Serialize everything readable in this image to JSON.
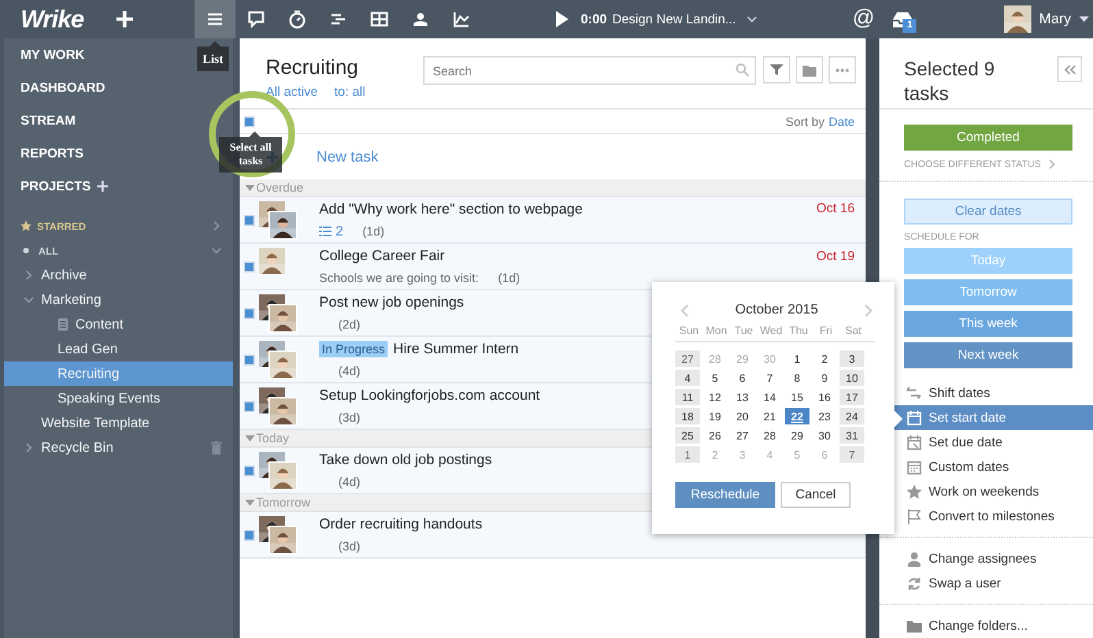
{
  "topbar": {
    "logo": "Wrike",
    "toolbar": [
      {
        "kind": "list",
        "selected": true
      },
      {
        "kind": "comment",
        "selected": false
      },
      {
        "kind": "timer",
        "selected": false
      },
      {
        "kind": "gantt",
        "selected": false
      },
      {
        "kind": "table",
        "selected": false
      },
      {
        "kind": "workload",
        "selected": false
      },
      {
        "kind": "chart",
        "selected": false
      }
    ],
    "tooltip": "List",
    "timer": {
      "time": "0:00",
      "task": "Design New Landin..."
    },
    "mentions": "@",
    "inbox_badge": "1",
    "user": "Mary"
  },
  "sidebar": {
    "nav": [
      "MY WORK",
      "DASHBOARD",
      "STREAM",
      "REPORTS"
    ],
    "projects_label": "PROJECTS",
    "starred": {
      "label": "STARRED",
      "expanded": false
    },
    "all": {
      "label": "ALL",
      "expanded": true
    },
    "tree": [
      {
        "label": "Archive",
        "kind": "folder",
        "expanded": false,
        "selected": false
      },
      {
        "label": "Marketing",
        "kind": "folder",
        "expanded": true,
        "selected": false,
        "children": [
          {
            "label": "Content",
            "kind": "document",
            "selected": false
          },
          {
            "label": "Lead Gen",
            "kind": "folder",
            "selected": false
          },
          {
            "label": "Recruiting",
            "kind": "folder",
            "selected": true
          },
          {
            "label": "Speaking Events",
            "kind": "folder",
            "selected": false
          }
        ]
      },
      {
        "label": "Website Template",
        "kind": "folder",
        "selected": false
      },
      {
        "label": "Recycle Bin",
        "kind": "bin",
        "expanded": false,
        "selected": false
      }
    ]
  },
  "list": {
    "title": "Recruiting",
    "filters": [
      "All active",
      "to: all"
    ],
    "search": {
      "placeholder": "Search"
    },
    "select_all": {
      "checked": true
    },
    "tooltip": "Select all tasks",
    "sort_label": "Sort by",
    "sort_value": "Date",
    "new_task": "New task",
    "groups": [
      {
        "label": "Overdue",
        "tasks": [
          {
            "title": "Add \"Why work here\" section to webpage",
            "checked": true,
            "subtasks": "2",
            "duration": "(1d)",
            "due": "Oct 16"
          },
          {
            "title": "College Career Fair",
            "checked": true,
            "description": "Schools we are going to visit:",
            "duration": "(1d)",
            "due": "Oct 19"
          },
          {
            "title": "Post new job openings",
            "checked": true,
            "duration": "(2d)"
          },
          {
            "title": "Hire Summer Intern",
            "status": "In Progress",
            "checked": true,
            "duration": "(4d)"
          },
          {
            "title": "Setup Lookingforjobs.com account",
            "checked": true,
            "duration": "(3d)"
          }
        ]
      },
      {
        "label": "Today",
        "tasks": [
          {
            "title": "Take down old job postings",
            "checked": true,
            "duration": "(4d)"
          }
        ]
      },
      {
        "label": "Tomorrow",
        "tasks": [
          {
            "title": "Order recruiting handouts",
            "checked": true,
            "duration": "(3d)"
          }
        ]
      }
    ]
  },
  "panel": {
    "title": "Selected 9 tasks",
    "status_button": "Completed",
    "status_link": "CHOOSE DIFFERENT STATUS",
    "clear_dates": "Clear dates",
    "schedule_label": "SCHEDULE FOR",
    "schedule": [
      {
        "label": "Today",
        "color": "#9dd0fa"
      },
      {
        "label": "Tomorrow",
        "color": "#7fbdf0"
      },
      {
        "label": "This week",
        "color": "#6aa6df"
      },
      {
        "label": "Next week",
        "color": "#6393c5"
      }
    ],
    "date_actions": [
      {
        "kind": "shift",
        "label": "Shift dates",
        "selected": false
      },
      {
        "kind": "start",
        "label": "Set start date",
        "selected": true
      },
      {
        "kind": "due",
        "label": "Set due date",
        "selected": false
      },
      {
        "kind": "custom",
        "label": "Custom dates",
        "selected": false
      },
      {
        "kind": "weekends",
        "label": "Work on weekends",
        "selected": false
      },
      {
        "kind": "milestones",
        "label": "Convert to milestones",
        "selected": false
      }
    ],
    "user_actions": [
      {
        "kind": "assignees",
        "label": "Change assignees",
        "selected": false
      },
      {
        "kind": "swap",
        "label": "Swap a user",
        "selected": false
      }
    ],
    "folder_actions": [
      {
        "kind": "folders",
        "label": "Change folders...",
        "selected": false
      }
    ]
  },
  "calendar": {
    "month": "October 2015",
    "weekdays": [
      "Sun",
      "Mon",
      "Tue",
      "Wed",
      "Thu",
      "Fri",
      "Sat"
    ],
    "weeks": [
      [
        {
          "day": "27",
          "muted": true,
          "selected": false
        },
        {
          "day": "28",
          "muted": true,
          "selected": false
        },
        {
          "day": "29",
          "muted": true,
          "selected": false
        },
        {
          "day": "30",
          "muted": true,
          "selected": false
        },
        {
          "day": "1",
          "muted": false,
          "selected": false
        },
        {
          "day": "2",
          "muted": false,
          "selected": false
        },
        {
          "day": "3",
          "muted": false,
          "selected": false
        }
      ],
      [
        {
          "day": "4",
          "muted": false,
          "selected": false
        },
        {
          "day": "5",
          "muted": false,
          "selected": false
        },
        {
          "day": "6",
          "muted": false,
          "selected": false
        },
        {
          "day": "7",
          "muted": false,
          "selected": false
        },
        {
          "day": "8",
          "muted": false,
          "selected": false
        },
        {
          "day": "9",
          "muted": false,
          "selected": false
        },
        {
          "day": "10",
          "muted": false,
          "selected": false
        }
      ],
      [
        {
          "day": "11",
          "muted": false,
          "selected": false
        },
        {
          "day": "12",
          "muted": false,
          "selected": false
        },
        {
          "day": "13",
          "muted": false,
          "selected": false
        },
        {
          "day": "14",
          "muted": false,
          "selected": false
        },
        {
          "day": "15",
          "muted": false,
          "selected": false
        },
        {
          "day": "16",
          "muted": false,
          "selected": false
        },
        {
          "day": "17",
          "muted": false,
          "selected": false
        }
      ],
      [
        {
          "day": "18",
          "muted": false,
          "selected": false
        },
        {
          "day": "19",
          "muted": false,
          "selected": false
        },
        {
          "day": "20",
          "muted": false,
          "selected": false
        },
        {
          "day": "21",
          "muted": false,
          "selected": false
        },
        {
          "day": "22",
          "muted": false,
          "selected": true
        },
        {
          "day": "23",
          "muted": false,
          "selected": false
        },
        {
          "day": "24",
          "muted": false,
          "selected": false
        }
      ],
      [
        {
          "day": "25",
          "muted": false,
          "selected": false
        },
        {
          "day": "26",
          "muted": false,
          "selected": false
        },
        {
          "day": "27",
          "muted": false,
          "selected": false
        },
        {
          "day": "28",
          "muted": false,
          "selected": false
        },
        {
          "day": "29",
          "muted": false,
          "selected": false
        },
        {
          "day": "30",
          "muted": false,
          "selected": false
        },
        {
          "day": "31",
          "muted": false,
          "selected": false
        }
      ],
      [
        {
          "day": "1",
          "muted": true,
          "selected": false
        },
        {
          "day": "2",
          "muted": true,
          "selected": false
        },
        {
          "day": "3",
          "muted": true,
          "selected": false
        },
        {
          "day": "4",
          "muted": true,
          "selected": false
        },
        {
          "day": "5",
          "muted": true,
          "selected": false
        },
        {
          "day": "6",
          "muted": true,
          "selected": false
        },
        {
          "day": "7",
          "muted": true,
          "selected": false
        }
      ]
    ],
    "buttons": [
      "Reschedule",
      "Cancel"
    ]
  }
}
